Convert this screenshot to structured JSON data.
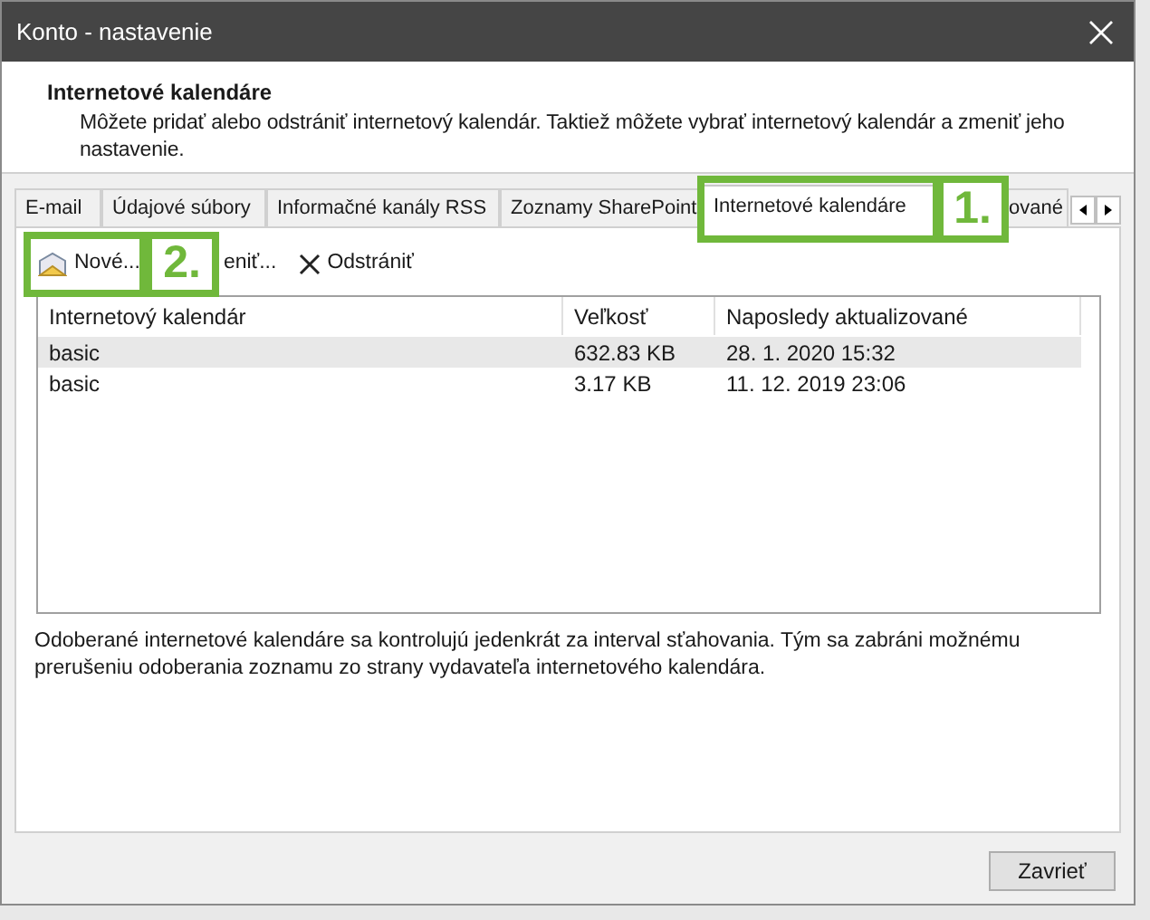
{
  "window": {
    "title": "Konto - nastavenie"
  },
  "header": {
    "title": "Internetové kalendáre",
    "description": "Môžete pridať alebo odstrániť internetový kalendár. Taktiež môžete vybrať internetový kalendár a zmeniť jeho nastavenie."
  },
  "tabs": [
    {
      "label": "E-mail",
      "selected": false
    },
    {
      "label": "Údajové súbory",
      "selected": false
    },
    {
      "label": "Informačné kanály RSS",
      "selected": false
    },
    {
      "label": "Zoznamy SharePoint",
      "selected": false
    },
    {
      "label": "Internetové kalendáre",
      "selected": true
    },
    {
      "label": "ované",
      "selected": false
    }
  ],
  "toolbar": [
    {
      "kind": "new",
      "label": "Nové..."
    },
    {
      "kind": "edit",
      "label": "eniť..."
    },
    {
      "kind": "delete",
      "label": "Odstrániť"
    }
  ],
  "table": {
    "columns": [
      "Internetový kalendár",
      "Veľkosť",
      "Naposledy aktualizované"
    ],
    "rows": [
      {
        "cells": [
          "basic",
          "632.83 KB",
          "28. 1. 2020 15:32"
        ],
        "selected": true
      },
      {
        "cells": [
          "basic",
          "3.17 KB",
          "11. 12. 2019 23:06"
        ],
        "selected": false
      }
    ]
  },
  "note": "Odoberané internetové kalendáre sa kontrolujú jedenkrát za interval sťahovania. Tým sa zabráni možnému prerušeniu odoberania zoznamu zo strany vydavateľa internetového kalendára.",
  "close_button": "Zavrieť",
  "annotations": [
    "1.",
    "2."
  ]
}
